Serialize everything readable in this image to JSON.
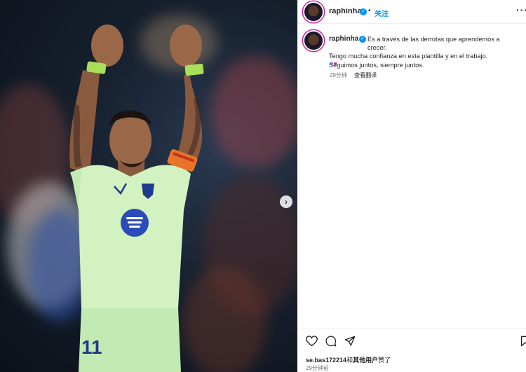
{
  "post": {
    "username": "raphinha",
    "follow_dot": "•",
    "follow_label": "关注",
    "more_label": "···"
  },
  "caption": {
    "username": "raphinha",
    "lines": [
      "Es a través de las derrotas que aprendemos a crecer.",
      "Tengo mucha confianza en esta plantilla y en el trabajo.",
      "Seguimos juntos, siempre juntos."
    ],
    "emoji": "💙❤️",
    "time": "29分钟",
    "translate_label": "查看翻译"
  },
  "photo": {
    "jersey_number": "11",
    "next_icon": "chevron-right-icon"
  },
  "footer": {
    "likes_user": "se.bas172214",
    "likes_and": "和",
    "likes_others": "其他用户",
    "likes_suffix": "赞了",
    "time": "29分钟前"
  },
  "colors": {
    "accent": "#0095f6",
    "jersey": "#d2f2c2",
    "wristband": "#a8e05a"
  }
}
